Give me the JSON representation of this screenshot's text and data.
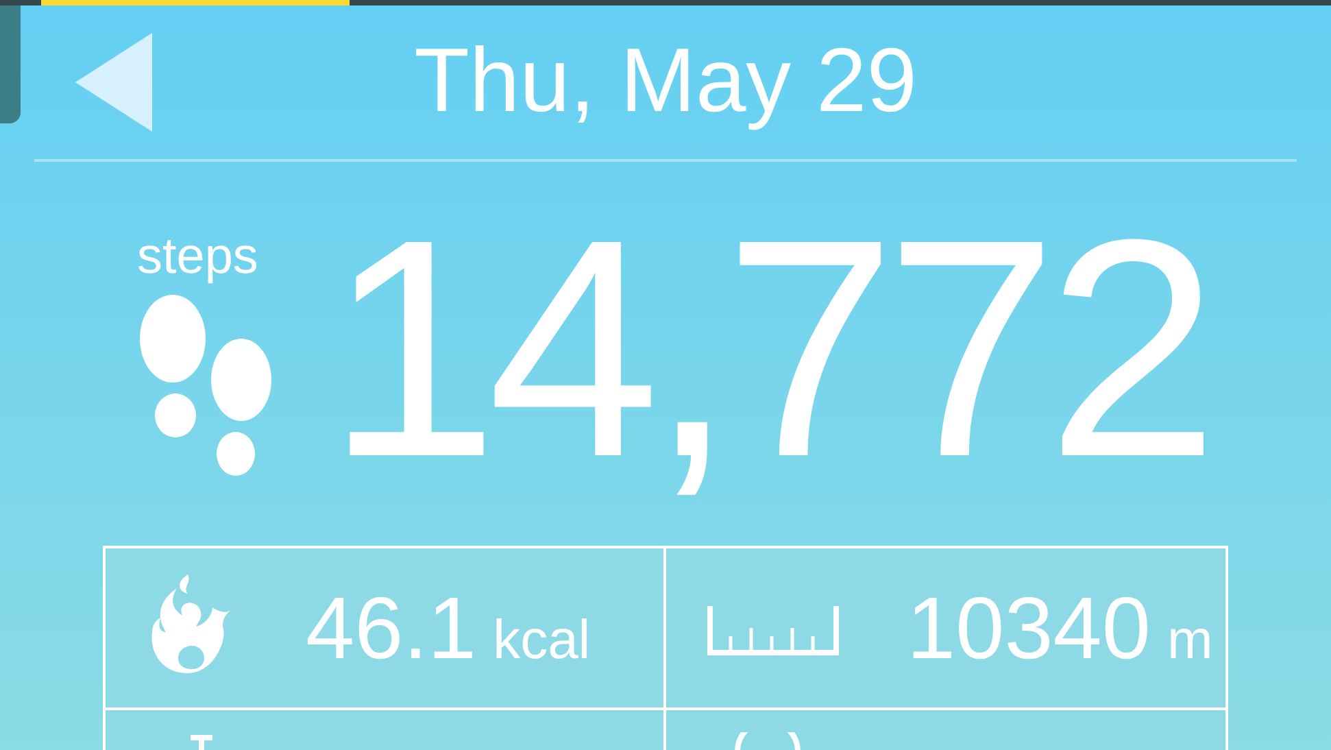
{
  "header": {
    "title": "Thu, May 29"
  },
  "steps": {
    "label": "steps",
    "value": "14,772"
  },
  "stats": [
    {
      "kind": "calories",
      "value": "46.1",
      "unit": "kcal"
    },
    {
      "kind": "distance",
      "value": "10340",
      "unit": "m"
    }
  ]
}
